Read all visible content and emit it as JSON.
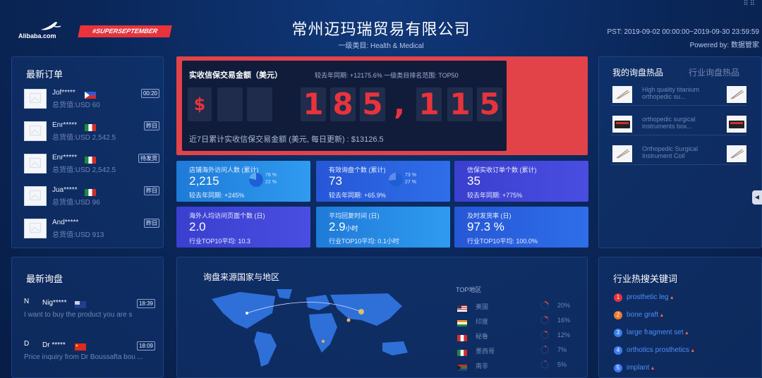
{
  "header": {
    "logo_text": "Alibaba.com",
    "campaign_badge": "#SUPERSEPTEMBER",
    "title": "常州迈玛瑞贸易有限公司",
    "subtitle": "一级类目: Health & Medical",
    "pst": "PST: 2019-09-02 00:00:00~2019-09-30 23:59:59",
    "powered": "Powered by: 数据管家",
    "window_controls": "⠿⠿"
  },
  "orders": {
    "title": "最新订单",
    "items": [
      {
        "name": "Jof*****",
        "amount": "总货值:USD 60",
        "tag": "00:20",
        "flag": "philippines"
      },
      {
        "name": "Enr*****",
        "amount": "总货值:USD 2,542.5",
        "tag": "昨日",
        "flag": "mexico"
      },
      {
        "name": "Enr*****",
        "amount": "总货值:USD 2,542.5",
        "tag": "待发货",
        "flag": "mexico"
      },
      {
        "name": "Jua*****",
        "amount": "总货值:USD 96",
        "tag": "昨日",
        "flag": "mexico"
      },
      {
        "name": "And*****",
        "amount": "总货值:USD 913",
        "tag": "昨日",
        "flag": "none"
      }
    ]
  },
  "gmv": {
    "label": "实收信保交易金额（美元）",
    "yoy": "较去年同期: +12175.6%  一级类目排名范围: TOP50",
    "currency": "$",
    "digits": [
      "",
      "",
      "1",
      "8",
      "5",
      ",",
      "1",
      "1",
      "5"
    ],
    "footer": "近7日累计实收信保交易金额 (美元, 每日更新) : $13126.5",
    "accent": "#e8333c"
  },
  "cards": [
    {
      "title": "店铺海外访问人数 (累计)",
      "value": "2,215",
      "unit": "",
      "foot": "较去年同期: +245%",
      "pie": [
        "78 %",
        "22 %"
      ],
      "pie_share": 0.78
    },
    {
      "title": "有效询盘个数 (累计)",
      "value": "73",
      "unit": "",
      "foot": "较去年同期: +65.9%",
      "pie": [
        "73 %",
        "27 %"
      ],
      "pie_share": 0.73
    },
    {
      "title": "信保实收订单个数 (累计)",
      "value": "35",
      "unit": "",
      "foot": "较去年同期: +775%",
      "pie": [],
      "pie_share": null
    },
    {
      "title": "海外人均访问页面个数 (日)",
      "value": "2.0",
      "unit": "",
      "foot": "行业TOP10平均: 10.3",
      "pie": [],
      "pie_share": null
    },
    {
      "title": "平均回复时间 (日)",
      "value": "2.9",
      "unit": "小时",
      "foot": "行业TOP10平均: 0.1小时",
      "pie": [],
      "pie_share": null
    },
    {
      "title": "及时发货率 (日)",
      "value": "97.3 %",
      "unit": "",
      "foot": "行业TOP10平均: 100.0%",
      "pie": [],
      "pie_share": null
    }
  ],
  "hot": {
    "tab_mine": "我的询盘热品",
    "tab_industry": "行业询盘热品",
    "items": [
      {
        "name": "High quality titanium orthopedic su..."
      },
      {
        "name": "orthopedic surgical instruments box..."
      },
      {
        "name": "Orthopedic Surgical Instrument Coil"
      }
    ]
  },
  "inquiries": {
    "title": "最新询盘",
    "items": [
      {
        "initial": "N",
        "name": "Nig*****",
        "time": "18:39",
        "msg": "I want to buy the product you are s",
        "flag": "australia"
      },
      {
        "initial": "D",
        "name": "Dr *****",
        "time": "18:09",
        "msg": "Price inquiry from Dr Boussafta bou ...",
        "flag": "china"
      }
    ]
  },
  "map": {
    "title": "询盘来源国家与地区",
    "top_title": "TOP地区",
    "top": [
      {
        "country": "美国",
        "pct": "20%",
        "share": 0.2,
        "flag": "usa"
      },
      {
        "country": "印度",
        "pct": "16%",
        "share": 0.16,
        "flag": "india"
      },
      {
        "country": "秘鲁",
        "pct": "12%",
        "share": 0.12,
        "flag": "peru"
      },
      {
        "country": "墨西哥",
        "pct": "7%",
        "share": 0.07,
        "flag": "mexico"
      },
      {
        "country": "南非",
        "pct": "5%",
        "share": 0.05,
        "flag": "south-africa"
      }
    ]
  },
  "keywords": {
    "title": "行业热搜关键词",
    "items": [
      {
        "rank": "1",
        "word": "prosthetic leg",
        "arrow": "▴",
        "color": "#e8333c"
      },
      {
        "rank": "2",
        "word": "bone graft",
        "arrow": "▴",
        "color": "#f07a2a"
      },
      {
        "rank": "3",
        "word": "large fragment set",
        "arrow": "▴",
        "color": "#3b7cf0"
      },
      {
        "rank": "4",
        "word": "orthotics prosthetics",
        "arrow": "▴",
        "color": "#3b7cf0"
      },
      {
        "rank": "5",
        "word": "implant",
        "arrow": "▴",
        "color": "#3b7cf0"
      }
    ]
  },
  "side_tab": "◀"
}
